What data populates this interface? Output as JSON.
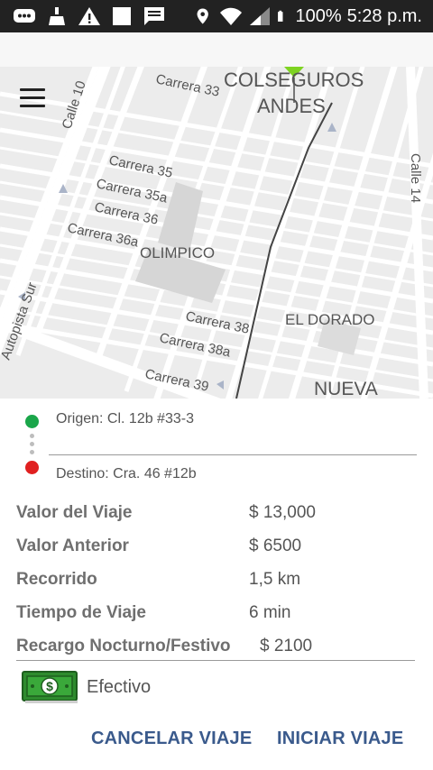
{
  "status_bar": {
    "battery": "100%",
    "time": "5:28 p.m."
  },
  "map": {
    "labels": {
      "neighborhood_colseguros": "COLSEGUROS",
      "neighborhood_andes": "ANDES",
      "neighborhood_olimpico": "OLIMPICO",
      "neighborhood_el_dorado": "EL DORADO",
      "neighborhood_nueva": "NUEVA",
      "street_carrera_33": "Carrera 33",
      "street_calle_10": "Calle 10",
      "street_carrera_35": "Carrera 35",
      "street_carrera_35a": "Carrera 35a",
      "street_carrera_36": "Carrera 36",
      "street_carrera_36a": "Carrera 36a",
      "street_carrera_38": "Carrera 38",
      "street_carrera_38a": "Carrera 38a",
      "street_carrera_39": "Carrera 39",
      "street_calle_14": "Calle 14",
      "street_autopista_sur": "Autopista Sur"
    },
    "colors": {
      "origin": "#1aa64a",
      "destination": "#e02020",
      "marker": "#7ed321"
    }
  },
  "trip": {
    "origin_label": "Origen: Cl. 12b #33-3",
    "destination_label": "Destino: Cra. 46 #12b"
  },
  "details": [
    {
      "label": "Valor del Viaje",
      "value": "$ 13,000"
    },
    {
      "label": "Valor Anterior",
      "value": "$ 6500"
    },
    {
      "label": "Recorrido",
      "value": "1,5 km"
    },
    {
      "label": "Tiempo de Viaje",
      "value": "6 min"
    },
    {
      "label": "Recargo Nocturno/Festivo",
      "value": "$ 2100"
    }
  ],
  "payment": {
    "method": "Efectivo",
    "icon": "cash-icon"
  },
  "actions": {
    "cancel_label": "CANCELAR VIAJE",
    "start_label": "INICIAR VIAJE"
  }
}
